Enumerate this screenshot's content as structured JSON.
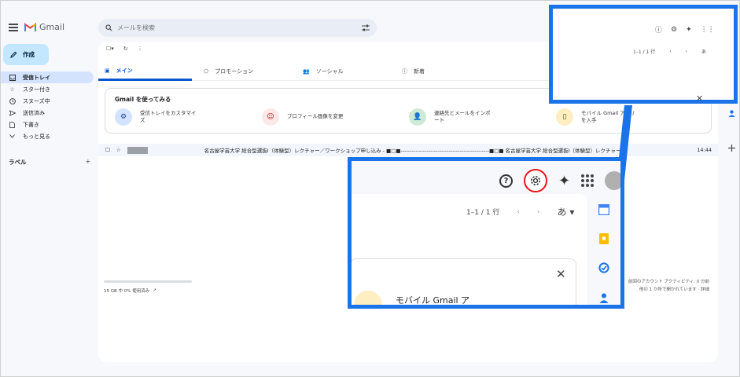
{
  "header": {
    "app_name": "Gmail",
    "search_placeholder": "メールを検索"
  },
  "compose": {
    "label": "作成"
  },
  "sidebar": {
    "items": [
      {
        "label": "受信トレイ",
        "icon": "inbox-icon",
        "active": true
      },
      {
        "label": "スター付き",
        "icon": "star-icon",
        "active": false
      },
      {
        "label": "スヌーズ中",
        "icon": "clock-icon",
        "active": false
      },
      {
        "label": "送信済み",
        "icon": "send-icon",
        "active": false
      },
      {
        "label": "下書き",
        "icon": "draft-icon",
        "active": false
      },
      {
        "label": "もっと見る",
        "icon": "chevron-down-icon",
        "active": false
      }
    ],
    "labels_heading": "ラベル",
    "labels_add": "+"
  },
  "storage": {
    "text": "15 GB 中 0% 使用済み"
  },
  "tabs": [
    {
      "label": "メイン",
      "icon": "inbox-icon",
      "active": true
    },
    {
      "label": "プロモーション",
      "icon": "tag-icon",
      "active": false
    },
    {
      "label": "ソーシャル",
      "icon": "people-icon",
      "active": false
    },
    {
      "label": "新着",
      "icon": "info-icon",
      "active": false
    }
  ],
  "getting_started": {
    "title": "Gmail を使ってみる",
    "steps": [
      {
        "label": "受信トレイをカスタマイズ",
        "icon": "gear-icon",
        "color": "#d3e3fd"
      },
      {
        "label": "プロフィール画像を変更",
        "icon": "account-icon",
        "color": "#fce8e6"
      },
      {
        "label": "連絡先とメールをインポート",
        "icon": "person-add-icon",
        "color": "#ceead6"
      },
      {
        "label": "モバイル Gmail アプリを入手",
        "icon": "phone-icon",
        "color": "#feefc3"
      }
    ]
  },
  "mail": {
    "subject": "名古屋学芸大学 総合型選抜Ⅰ（体験型）レクチャー／ワークショップ申し込み - ■□■------------------------------------------------■□■ 名古屋学芸大学 総合型選抜Ⅰ（体験型）レクチャー...",
    "time": "14:44"
  },
  "footer": {
    "line1": "前回のアカウント アクティビティ: 0 分前",
    "line2": "他の 1 か所で開かれています · 詳細"
  },
  "pager": {
    "range": "1–1 / 1 行",
    "lang": "あ"
  },
  "zoom_big": {
    "mobile_label": "モバイル Gmail ア"
  },
  "colors": {
    "accent": "#1a73e8",
    "highlight": "#e8141a"
  }
}
